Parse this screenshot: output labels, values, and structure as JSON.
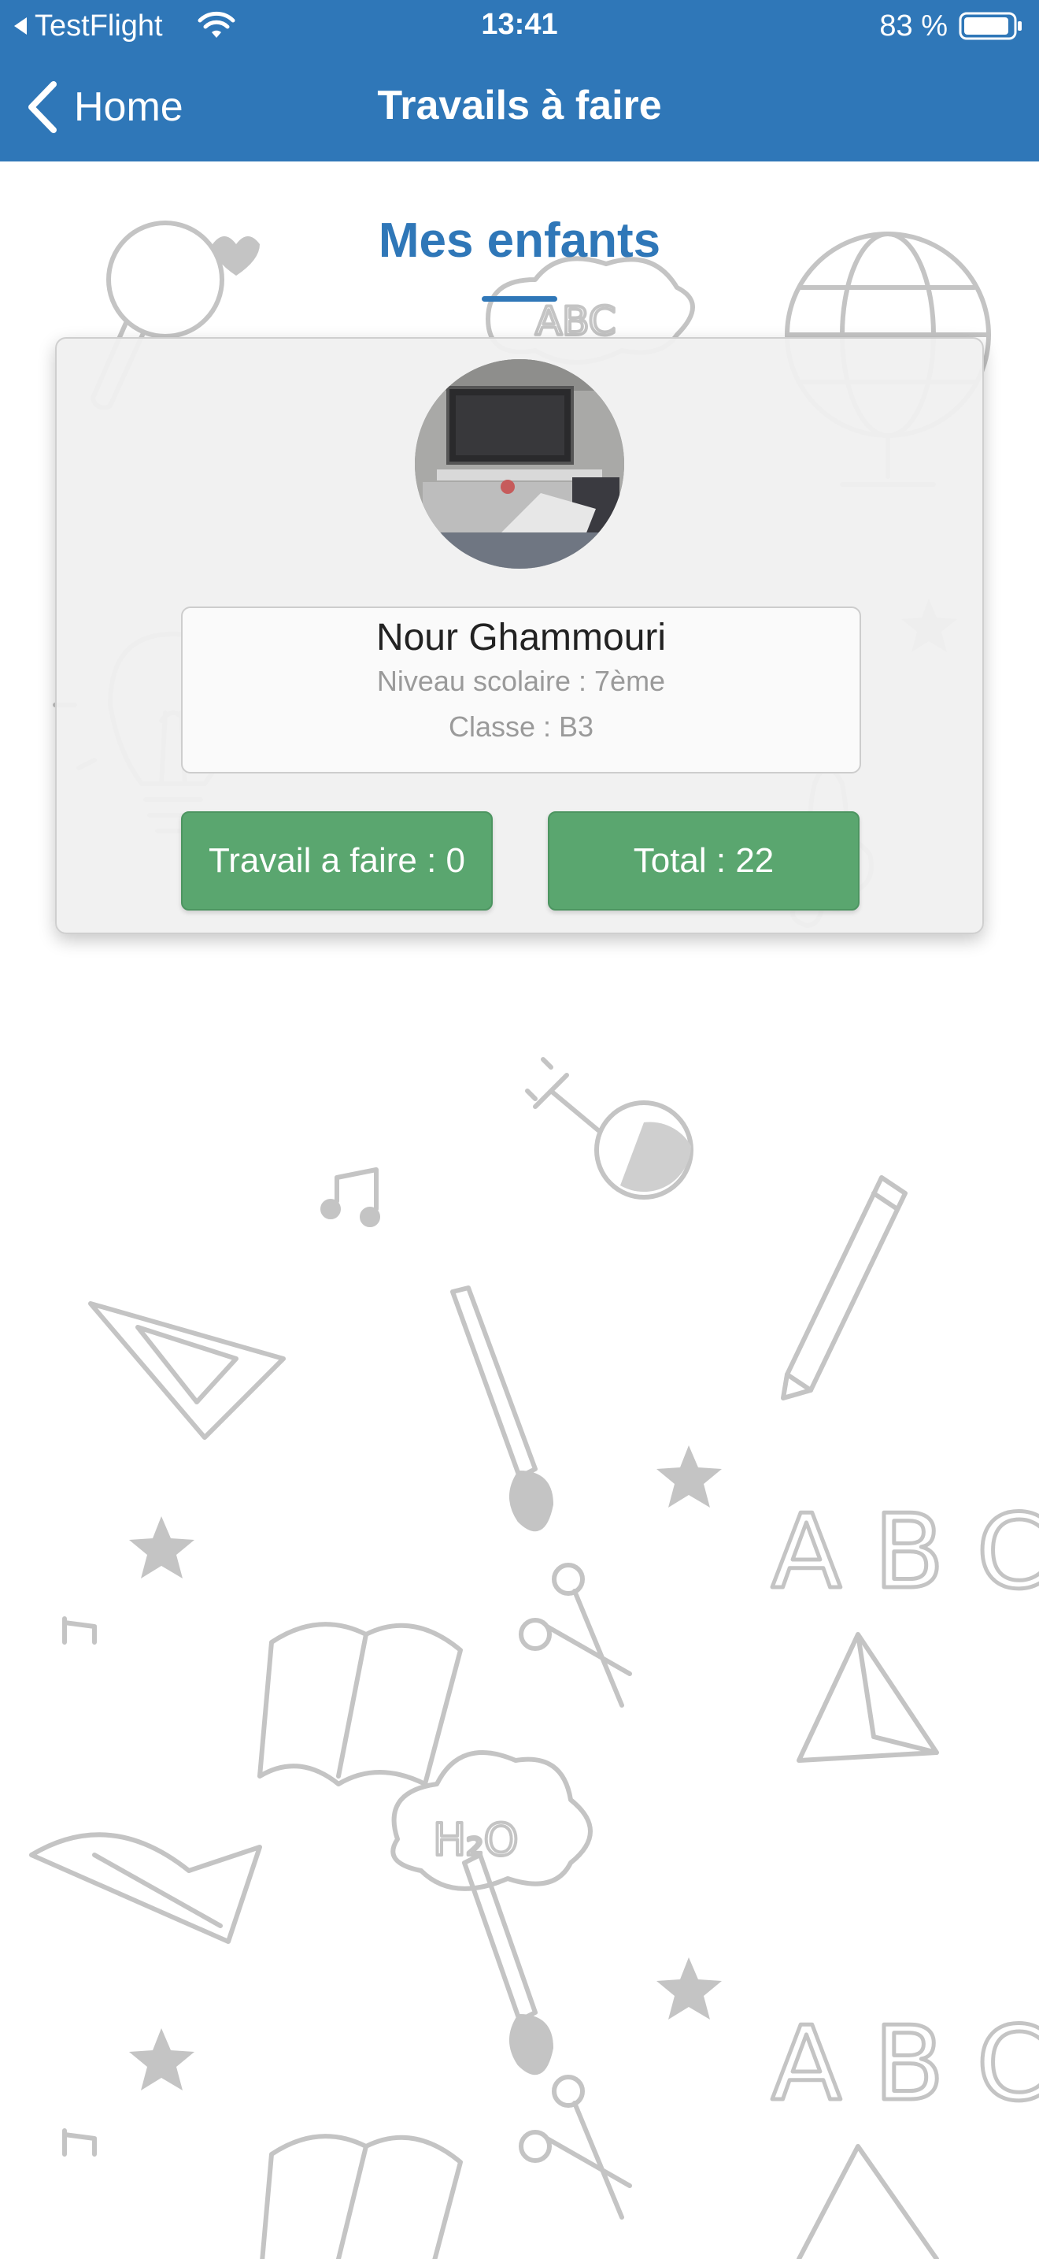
{
  "status_bar": {
    "back_app": "TestFlight",
    "time": "13:41",
    "battery": "83 %"
  },
  "nav": {
    "back_label": "Home",
    "title": "Travails à faire"
  },
  "section": {
    "title": "Mes enfants"
  },
  "child": {
    "name": "Nour Ghammouri",
    "level": "Niveau scolaire : 7ème",
    "class": "Classe : B3",
    "todo_button": "Travail a faire : 0",
    "total_button": "Total : 22"
  },
  "colors": {
    "accent": "#2f77b8",
    "button_green": "#5aa66f",
    "doodle_grey": "#c4c4c4"
  },
  "icons": {
    "back": "chevron-left-icon",
    "wifi": "wifi-icon",
    "battery": "battery-icon"
  }
}
